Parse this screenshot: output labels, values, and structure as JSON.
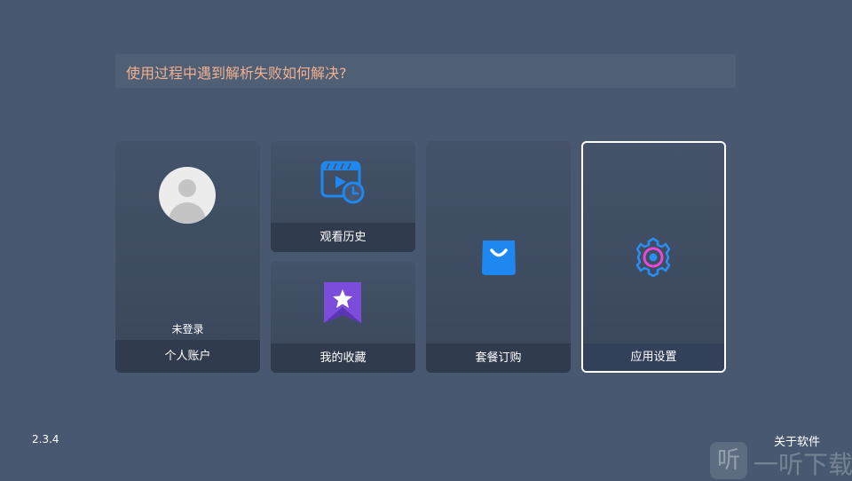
{
  "banner": {
    "text": "使用过程中遇到解析失败如何解决?"
  },
  "cards": {
    "account": {
      "status": "未登录",
      "label": "个人账户"
    },
    "history": {
      "label": "观看历史"
    },
    "favorites": {
      "label": "我的收藏"
    },
    "plans": {
      "label": "套餐订购"
    },
    "settings": {
      "label": "应用设置"
    }
  },
  "icons": {
    "account": "avatar-icon",
    "history": "video-history-icon",
    "favorites": "bookmark-star-icon",
    "plans": "shopping-bag-icon",
    "settings": "gear-icon"
  },
  "footer": {
    "version": "2.3.4",
    "about_label": "关于软件"
  },
  "watermark": {
    "logo_glyph": "听",
    "text": "一听下载"
  },
  "colors": {
    "background": "#475870",
    "banner_text": "#f2b08e",
    "accent_blue": "#1e88f0",
    "bookmark_purple": "#7c4ddb",
    "gear_pink": "#e54bd6"
  }
}
